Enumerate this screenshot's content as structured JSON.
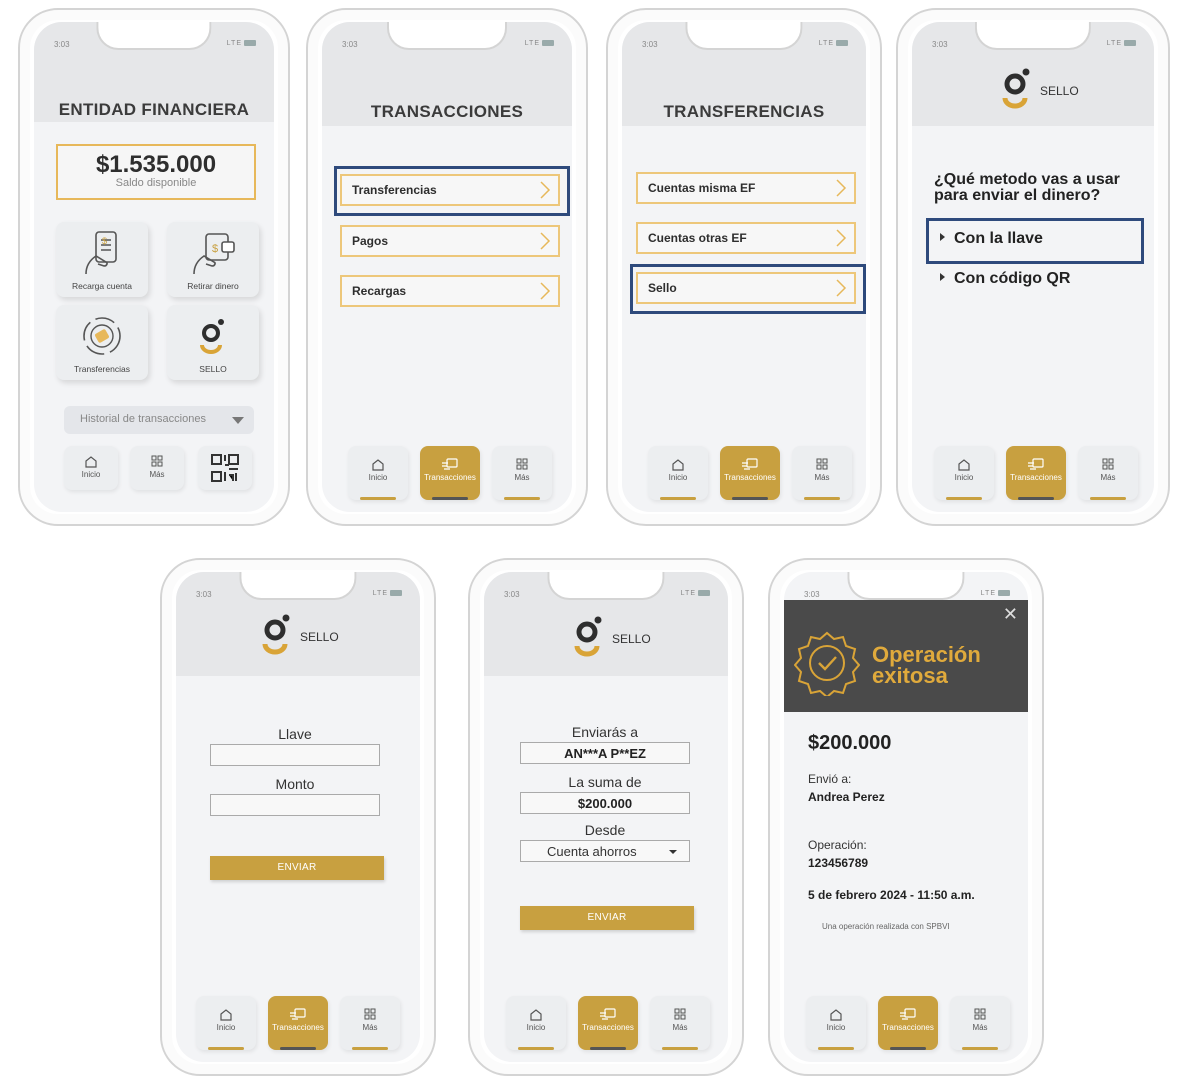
{
  "status": {
    "time": "3:03",
    "network": "LTE"
  },
  "nav": {
    "home": "Inicio",
    "transactions": "Transacciones",
    "more": "Más"
  },
  "screen1": {
    "title": "ENTIDAD FINANCIERA",
    "balance": "$1.535.000",
    "balance_label": "Saldo disponible",
    "tiles": [
      "Recarga cuenta",
      "Retirar dinero",
      "Transferencias",
      "SELLO"
    ],
    "history": "Historial de transacciones"
  },
  "screen2": {
    "title": "TRANSACCIONES",
    "items": [
      "Transferencias",
      "Pagos",
      "Recargas"
    ]
  },
  "screen3": {
    "title": "TRANSFERENCIAS",
    "items": [
      "Cuentas misma EF",
      "Cuentas otras EF",
      "Sello"
    ]
  },
  "sello": {
    "brand": "SELLO"
  },
  "screen4": {
    "question_line1": "¿Qué metodo vas a usar",
    "question_line2": "para enviar el dinero?",
    "option1": "Con la llave",
    "option2": "Con código QR"
  },
  "screen5": {
    "key_label": "Llave",
    "amount_label": "Monto",
    "send": "ENVIAR"
  },
  "screen6": {
    "to_label": "Enviarás a",
    "to_value": "AN***A P**EZ",
    "sum_label": "La suma de",
    "sum_value": "$200.000",
    "from_label": "Desde",
    "from_value": "Cuenta ahorros",
    "send": "ENVIAR"
  },
  "screen7": {
    "title_line1": "Operación",
    "title_line2": "exitosa",
    "amount": "$200.000",
    "sent_to_label": "Envió a:",
    "sent_to_value": "Andrea Perez",
    "operation_label": "Operación:",
    "operation_value": "123456789",
    "date": "5 de febrero 2024 - 11:50 a.m.",
    "note": "Una operación realizada con SPBVI"
  },
  "colors": {
    "gold": "#c8a040",
    "gold_light": "#edc77a",
    "highlight": "#2e4a7c",
    "dark": "#4a4a4a"
  }
}
